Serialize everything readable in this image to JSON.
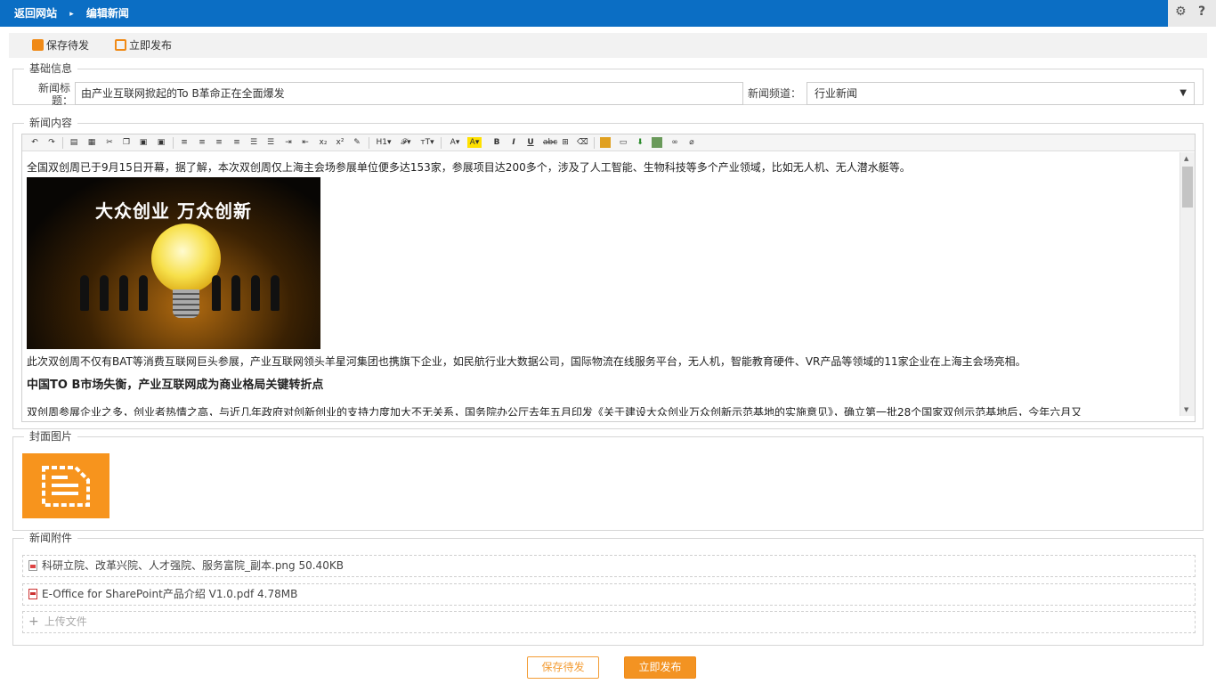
{
  "colors": {
    "topbar": "#0b6ec4",
    "accent": "#f39322",
    "cover_bg": "#f7941d"
  },
  "topbar": {
    "back_link": "返回网站",
    "separator_icon": "chevron-right-icon",
    "current": "编辑新闻",
    "icons": [
      "gear-icon",
      "help-icon"
    ],
    "settings_glyph": "⚙",
    "help_glyph": "?"
  },
  "actions": {
    "save_draft": "保存待发",
    "publish_now": "立即发布"
  },
  "basic": {
    "legend": "基础信息",
    "title_label_line1": "新闻标",
    "title_label_line2": "题：",
    "title_value": "由产业互联网掀起的To B革命正在全面爆发",
    "channel_label": "新闻频道：",
    "channel_value": "行业新闻"
  },
  "content": {
    "legend": "新闻内容",
    "toolbar_icons": [
      "undo-icon",
      "redo-icon",
      "preview-icon",
      "template-icon",
      "cut-icon",
      "copy-icon",
      "paste-icon",
      "paste-text-icon",
      "align-left-icon",
      "align-center-icon",
      "align-right-icon",
      "justify-icon",
      "ordered-list-icon",
      "unordered-list-icon",
      "indent-icon",
      "outdent-icon",
      "subscript-icon",
      "superscript-icon",
      "format-painter-icon",
      "heading-icon",
      "font-family-icon",
      "font-size-icon",
      "font-color-icon",
      "highlight-icon",
      "bold-icon",
      "italic-icon",
      "underline-icon",
      "strikethrough-icon",
      "table-icon",
      "clear-format-icon",
      "image-icon",
      "media-icon",
      "insert-icon",
      "picture-icon",
      "link-icon",
      "unlink-icon"
    ],
    "paragraph1": "全国双创周已于9月15日开幕，据了解，本次双创周仅上海主会场参展单位便多达153家，参展项目达200多个，涉及了人工智能、生物科技等多个产业领域，比如无人机、无人潜水艇等。",
    "banner_text": "大众创业  万众创新",
    "paragraph2": "此次双创周不仅有BAT等消费互联网巨头参展，产业互联网领头羊星河集团也携旗下企业，如民航行业大数据公司，国际物流在线服务平台，无人机，智能教育硬件、VR产品等领域的11家企业在上海主会场亮相。",
    "heading": "中国TO B市场失衡，产业互联网成为商业格局关键转折点",
    "paragraph3": "双创周参展企业之多，创业者热情之高，与近几年政府对创新创业的支持力度加大不无关系，国务院办公厅去年五月印发《关于建设大众创业万众创新示范基地的实施意见》，确立第一批28个国家双创示范基地后，今年六月又"
  },
  "cover": {
    "legend": "封面图片",
    "icon": "document-icon"
  },
  "attachments": {
    "legend": "新闻附件",
    "items": [
      {
        "name": "科研立院、改革兴院、人才强院、服务富院_副本.png 50.40KB",
        "icon": "image-file-icon"
      },
      {
        "name": "E-Office for SharePoint产品介绍 V1.0.pdf 4.78MB",
        "icon": "pdf-file-icon"
      }
    ],
    "upload_label": "上传文件",
    "upload_glyph": "+"
  },
  "footer": {
    "save_draft": "保存待发",
    "publish_now": "立即发布"
  }
}
